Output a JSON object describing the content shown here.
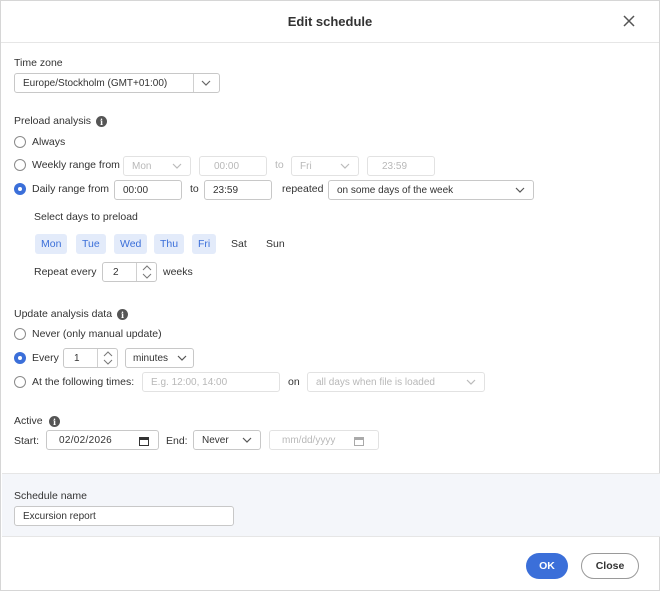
{
  "dialog": {
    "title": "Edit schedule"
  },
  "time_zone": {
    "label": "Time zone",
    "value": "Europe/Stockholm (GMT+01:00)"
  },
  "preload": {
    "label": "Preload analysis",
    "always_label": "Always",
    "weekly_label": "Weekly range from",
    "weekly_from_day": "Mon",
    "weekly_from_time": "00:00",
    "weekly_to_label": "to",
    "weekly_to_day": "Fri",
    "weekly_to_time": "23:59",
    "daily_label": "Daily range from",
    "daily_from_time": "00:00",
    "daily_to_label": "to",
    "daily_to_time": "23:59",
    "repeated_label": "repeated",
    "repeated_value": "on some days of the week",
    "select_days_label": "Select days to preload",
    "days": [
      "Mon",
      "Tue",
      "Wed",
      "Thu",
      "Fri",
      "Sat",
      "Sun"
    ],
    "days_selected": [
      true,
      true,
      true,
      true,
      true,
      false,
      false
    ],
    "repeat_every_label": "Repeat every",
    "repeat_every_value": "2",
    "weeks_label": "weeks",
    "selected_option": "daily"
  },
  "update": {
    "label": "Update analysis data",
    "never_label": "Never (only manual update)",
    "every_label": "Every",
    "every_value": "1",
    "every_unit": "minutes",
    "times_label": "At the following times:",
    "times_placeholder": "E.g. 12:00, 14:00",
    "on_label": "on",
    "on_value": "all days when file is loaded",
    "selected_option": "every"
  },
  "active": {
    "label": "Active",
    "start_label": "Start:",
    "start_value": "02/02/2026",
    "end_label": "End:",
    "end_value": "Never",
    "end_date_placeholder": "mm/dd/yyyy"
  },
  "schedule_name": {
    "label": "Schedule name",
    "value": "Excursion report"
  },
  "footer": {
    "ok_label": "OK",
    "close_label": "Close"
  },
  "colors": {
    "accent": "#3b6fd9",
    "day_selected_bg": "#e3ebfa"
  }
}
